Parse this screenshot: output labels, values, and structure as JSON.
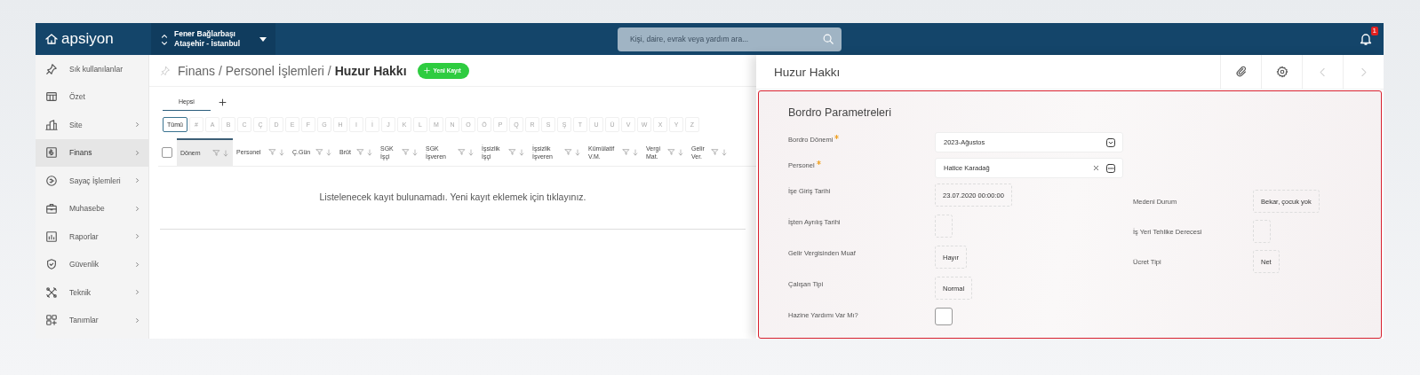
{
  "topbar": {
    "logo": "apsiyon",
    "site": {
      "name": "Fener Bağlarbaşı",
      "location": "Ataşehir - İstanbul"
    },
    "search": {
      "placeholder": "Kişi, daire, evrak veya yardım ara..."
    },
    "notifications": {
      "badge": "1"
    }
  },
  "sidebar": {
    "items": [
      {
        "label": "Sık kullanılanlar",
        "has_children": false,
        "selected": false
      },
      {
        "label": "Özet",
        "has_children": false,
        "selected": false
      },
      {
        "label": "Site",
        "has_children": true,
        "selected": false
      },
      {
        "label": "Finans",
        "has_children": true,
        "selected": true
      },
      {
        "label": "Sayaç İşlemleri",
        "has_children": true,
        "selected": false
      },
      {
        "label": "Muhasebe",
        "has_children": true,
        "selected": false
      },
      {
        "label": "Raporlar",
        "has_children": true,
        "selected": false
      },
      {
        "label": "Güvenlik",
        "has_children": true,
        "selected": false
      },
      {
        "label": "Teknik",
        "has_children": true,
        "selected": false
      },
      {
        "label": "Tanımlar",
        "has_children": true,
        "selected": false
      }
    ]
  },
  "main": {
    "breadcrumb": "Finans / Personel İşlemleri / **Huzur Hakkı**",
    "new_button": "Yeni Kayıt",
    "tabs": [
      {
        "label": "Hepsi",
        "selected": true
      }
    ],
    "letter_filter": [
      {
        "label": "Tümü",
        "selected": true,
        "disabled": false
      },
      {
        "label": "#",
        "selected": false,
        "disabled": true
      },
      {
        "label": "A",
        "selected": false,
        "disabled": true
      },
      {
        "label": "B",
        "selected": false,
        "disabled": true
      },
      {
        "label": "C",
        "selected": false,
        "disabled": true
      },
      {
        "label": "Ç",
        "selected": false,
        "disabled": true
      },
      {
        "label": "D",
        "selected": false,
        "disabled": true
      },
      {
        "label": "E",
        "selected": false,
        "disabled": true
      },
      {
        "label": "F",
        "selected": false,
        "disabled": true
      },
      {
        "label": "G",
        "selected": false,
        "disabled": true
      },
      {
        "label": "H",
        "selected": false,
        "disabled": true
      },
      {
        "label": "I",
        "selected": false,
        "disabled": true
      },
      {
        "label": "İ",
        "selected": false,
        "disabled": true
      },
      {
        "label": "J",
        "selected": false,
        "disabled": true
      },
      {
        "label": "K",
        "selected": false,
        "disabled": true
      },
      {
        "label": "L",
        "selected": false,
        "disabled": true
      },
      {
        "label": "M",
        "selected": false,
        "disabled": true
      },
      {
        "label": "N",
        "selected": false,
        "disabled": true
      },
      {
        "label": "O",
        "selected": false,
        "disabled": true
      },
      {
        "label": "Ö",
        "selected": false,
        "disabled": true
      },
      {
        "label": "P",
        "selected": false,
        "disabled": true
      },
      {
        "label": "Q",
        "selected": false,
        "disabled": true
      },
      {
        "label": "R",
        "selected": false,
        "disabled": true
      },
      {
        "label": "S",
        "selected": false,
        "disabled": true
      },
      {
        "label": "Ş",
        "selected": false,
        "disabled": true
      },
      {
        "label": "T",
        "selected": false,
        "disabled": true
      },
      {
        "label": "U",
        "selected": false,
        "disabled": true
      },
      {
        "label": "Ü",
        "selected": false,
        "disabled": true
      },
      {
        "label": "V",
        "selected": false,
        "disabled": true
      },
      {
        "label": "W",
        "selected": false,
        "disabled": true
      },
      {
        "label": "X",
        "selected": false,
        "disabled": true
      },
      {
        "label": "Y",
        "selected": false,
        "disabled": true
      },
      {
        "label": "Z",
        "selected": false,
        "disabled": true
      }
    ],
    "table": {
      "select_all_checked": false,
      "columns": [
        {
          "label": "Dönem",
          "sorted": true
        },
        {
          "label": "Personel",
          "sorted": false
        },
        {
          "label": "Ç.Gün",
          "sorted": false
        },
        {
          "label": "Brüt",
          "sorted": false
        },
        {
          "label": "SGK İşçi",
          "sorted": false
        },
        {
          "label": "SGK İşveren",
          "sorted": false
        },
        {
          "label": "İşsizlik İşçi",
          "sorted": false
        },
        {
          "label": "İşsizlik İşveren",
          "sorted": false
        },
        {
          "label": "Kümülatif V.M.",
          "sorted": false
        },
        {
          "label": "Vergi Mat.",
          "sorted": false
        },
        {
          "label": "Gelir Ver.",
          "sorted": false
        }
      ],
      "empty_message": "Listelenecek kayıt bulunamadı. Yeni kayıt eklemek için tıklayınız."
    }
  },
  "drawer": {
    "title": "Huzur Hakkı",
    "form": {
      "title": "Bordro Parametreleri",
      "top_fields": [
        {
          "label": "Bordro Dönemi",
          "required": true,
          "value": "2023-Ağustos",
          "kind": "select"
        },
        {
          "label": "Personel",
          "required": true,
          "value": "Hatice Karadağ",
          "kind": "lookup"
        }
      ],
      "left_fields": [
        {
          "label": "İşe Giriş Tarihi",
          "value": "23.07.2020 00:00:00",
          "kind": "text"
        },
        {
          "label": "İşten Ayrılış Tarihi",
          "kind": "text"
        },
        {
          "label": "Gelir Vergisinden Muaf",
          "value": "Hayır",
          "kind": "text"
        },
        {
          "label": "Çalışan Tipi",
          "value": "Normal",
          "kind": "text"
        },
        {
          "label": "Hazine Yardımı Var Mı?",
          "kind": "checkbox",
          "checked": false
        }
      ],
      "right_fields": [
        {
          "label": "Medeni Durum",
          "value": "Bekar, çocuk yok",
          "kind": "text"
        },
        {
          "label": "İş Yeri Tehlike Derecesi",
          "kind": "text"
        },
        {
          "label": "Ücret Tipi",
          "value": "Net",
          "kind": "text"
        }
      ]
    }
  }
}
